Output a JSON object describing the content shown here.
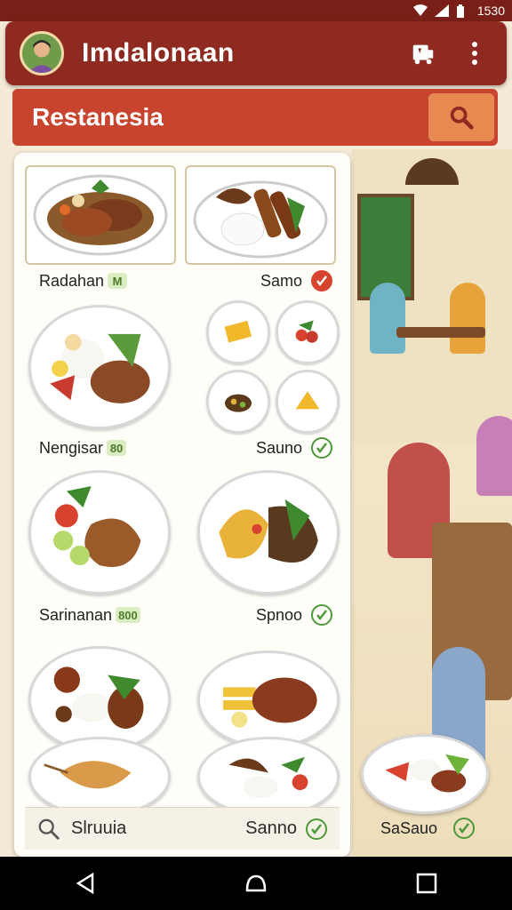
{
  "status_bar": {
    "time": "1530"
  },
  "app_bar": {
    "title": "Imdalonaan"
  },
  "restaurant_bar": {
    "label": "Restanesia"
  },
  "menu": {
    "row1": {
      "left_label": "Radahan",
      "left_tag": "M",
      "right_label": "Samo",
      "right_status": "selected"
    },
    "row2": {
      "left_label": "Nengisar",
      "left_tag": "80",
      "right_label": "Sauno",
      "right_status": "check"
    },
    "row3": {
      "left_label": "Sarinanan",
      "left_tag": "800",
      "right_label": "Spnoo",
      "right_status": "check"
    }
  },
  "footer": {
    "search_label": "Slruuia",
    "right_label": "Sanno"
  },
  "side": {
    "label": "SaSauo"
  },
  "colors": {
    "app_bar": "#8e2a20",
    "restaurant_bar": "#c8442e",
    "search_button": "#e78a52",
    "check_green": "#4c9a3a",
    "check_red": "#d8432f"
  }
}
